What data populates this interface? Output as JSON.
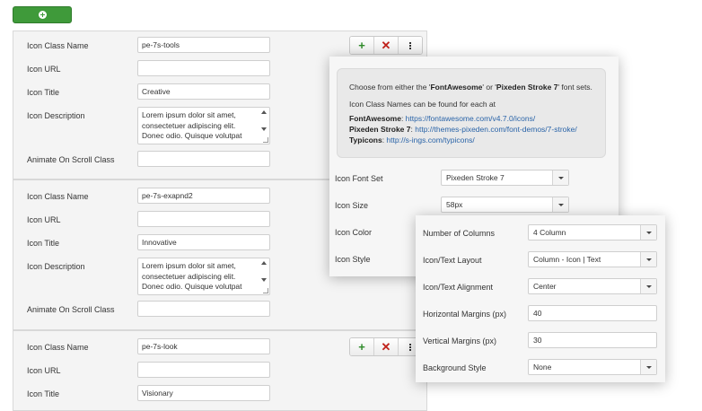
{
  "top_add_button": {
    "icon": "plus-circle-icon",
    "color": "#3f9a3a"
  },
  "items": [
    {
      "icon_class_name_label": "Icon Class Name",
      "icon_class_name_value": "pe-7s-tools",
      "icon_url_label": "Icon URL",
      "icon_url_value": "",
      "icon_title_label": "Icon Title",
      "icon_title_value": "Creative",
      "icon_description_label": "Icon Description",
      "icon_description_lines": [
        "Lorem ipsum dolor sit amet,",
        "consectetuer adipiscing elit.",
        "Donec odio. Quisque volutpat"
      ],
      "animate_label": "Animate On Scroll Class",
      "animate_value": ""
    },
    {
      "icon_class_name_label": "Icon Class Name",
      "icon_class_name_value": "pe-7s-exapnd2",
      "icon_url_label": "Icon URL",
      "icon_url_value": "",
      "icon_title_label": "Icon Title",
      "icon_title_value": "Innovative",
      "icon_description_label": "Icon Description",
      "icon_description_lines": [
        "Lorem ipsum dolor sit amet,",
        "consectetuer adipiscing elit.",
        "Donec odio. Quisque volutpat"
      ],
      "animate_label": "Animate On Scroll Class",
      "animate_value": ""
    },
    {
      "icon_class_name_label": "Icon Class Name",
      "icon_class_name_value": "pe-7s-look",
      "icon_url_label": "Icon URL",
      "icon_url_value": "",
      "icon_title_label": "Icon Title",
      "icon_title_value": "Visionary"
    }
  ],
  "item_actions": {
    "add_icon": "plus-icon",
    "remove_icon": "close-icon",
    "menu_icon": "more-vertical-icon"
  },
  "font_popup": {
    "info_line1_pre": "Choose from either the '",
    "info_line1_fa": "FontAwesome",
    "info_line1_mid": "' or '",
    "info_line1_pe": "Pixeden Stroke 7",
    "info_line1_post": "' font sets.",
    "info_line2": "Icon Class Names can be found for each at",
    "fa_label": "FontAwesome",
    "fa_link": "https://fontawesome.com/v4.7.0/icons/",
    "pe_label": "Pixeden Stroke 7",
    "pe_link": "http://themes-pixeden.com/font-demos/7-stroke/",
    "typ_label": "Typicons",
    "typ_link": "http://s-ings.com/typicons/",
    "icon_font_set_label": "Icon Font Set",
    "icon_font_set_value": "Pixeden Stroke 7",
    "icon_size_label": "Icon Size",
    "icon_size_value": "58px",
    "icon_color_label": "Icon Color",
    "icon_style_label": "Icon Style"
  },
  "layout_popup": {
    "columns_label": "Number of Columns",
    "columns_value": "4 Column",
    "layout_label": "Icon/Text Layout",
    "layout_value": "Column - Icon | Text",
    "alignment_label": "Icon/Text Alignment",
    "alignment_value": "Center",
    "h_margins_label": "Horizontal Margins (px)",
    "h_margins_value": "40",
    "v_margins_label": "Vertical Margins (px)",
    "v_margins_value": "30",
    "background_label": "Background Style",
    "background_value": "None"
  }
}
